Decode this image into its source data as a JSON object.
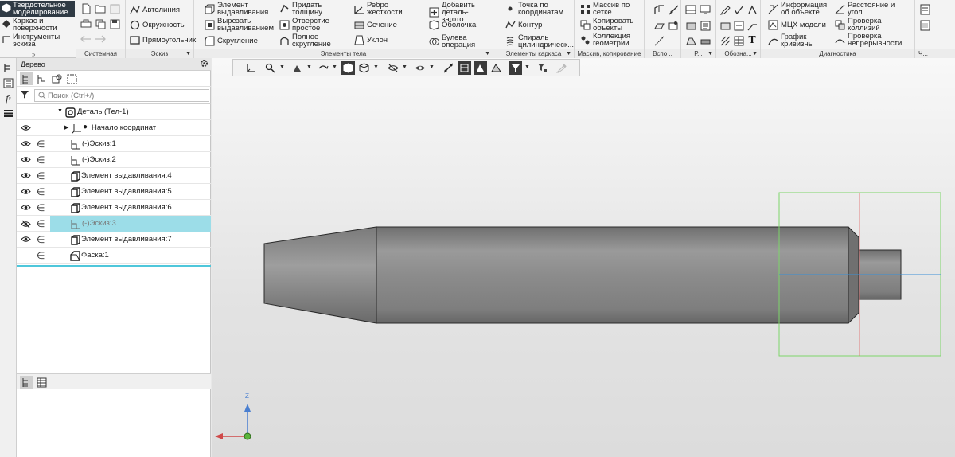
{
  "ribbon": {
    "modes": {
      "solid": "Твердотельное\nмоделирование",
      "frame": "Каркас и\nповерхности",
      "sketch_tools": "Инструменты\nэскиза"
    },
    "groups": {
      "system": "Системная",
      "sketch": "Эскиз",
      "body": "Элементы тела",
      "frame": "Элементы каркаса",
      "array": "Массив, копирование",
      "aux": "Вспо...",
      "r": "Р...",
      "notation": "Обозна...",
      "diag": "Диагностика",
      "ch": "Ч..."
    },
    "sketch_buttons": {
      "autoline": "Автолиния",
      "circle": "Окружность",
      "rectangle": "Прямоугольник"
    },
    "body_buttons": {
      "extrude": "Элемент\nвыдавливания",
      "cut_extrude": "Вырезать\nвыдавливанием",
      "fillet": "Скругление",
      "thickness": "Придать\nтолщину",
      "hole": "Отверстие\nпростое",
      "full_round": "Полное\nскругление",
      "rib": "Ребро\nжесткости",
      "section": "Сечение",
      "draft": "Уклон",
      "add_part": "Добавить\nдеталь-загото...",
      "shell": "Оболочка",
      "boolean": "Булева\nоперация"
    },
    "frame_buttons": {
      "point": "Точка по\nкоординатам",
      "contour": "Контур",
      "helix": "Спираль\nцилиндрическ..."
    },
    "array_buttons": {
      "grid_array": "Массив по\nсетке",
      "copy_objects": "Копировать\nобъекты",
      "geom_collection": "Коллекция\nгеометрии"
    },
    "diag_buttons": {
      "info": "Информация\nоб объекте",
      "mcs": "МЦХ модели",
      "curvature": "График\nкривизны",
      "distance": "Расстояние и\nугол",
      "collisions": "Проверка\nколлизий",
      "continuity": "Проверка\nнепрерывности"
    }
  },
  "tree": {
    "title": "Дерево",
    "search_placeholder": "Поиск (Ctrl+/)",
    "root": "Деталь (Тел-1)",
    "origin": "Начало координат",
    "items": [
      "Эскиз:1",
      "Эскиз:2",
      "Элемент выдавливания:4",
      "Элемент выдавливания:5",
      "Элемент выдавливания:6",
      "Эскиз:3",
      "Элемент выдавливания:7",
      "Фаска:1"
    ]
  },
  "viewport": {
    "axis_z_label": "Z"
  },
  "colors": {
    "selection": "#9cdde8",
    "active_mode": "#2f3a44",
    "body_shade": "#8a8a8a"
  }
}
